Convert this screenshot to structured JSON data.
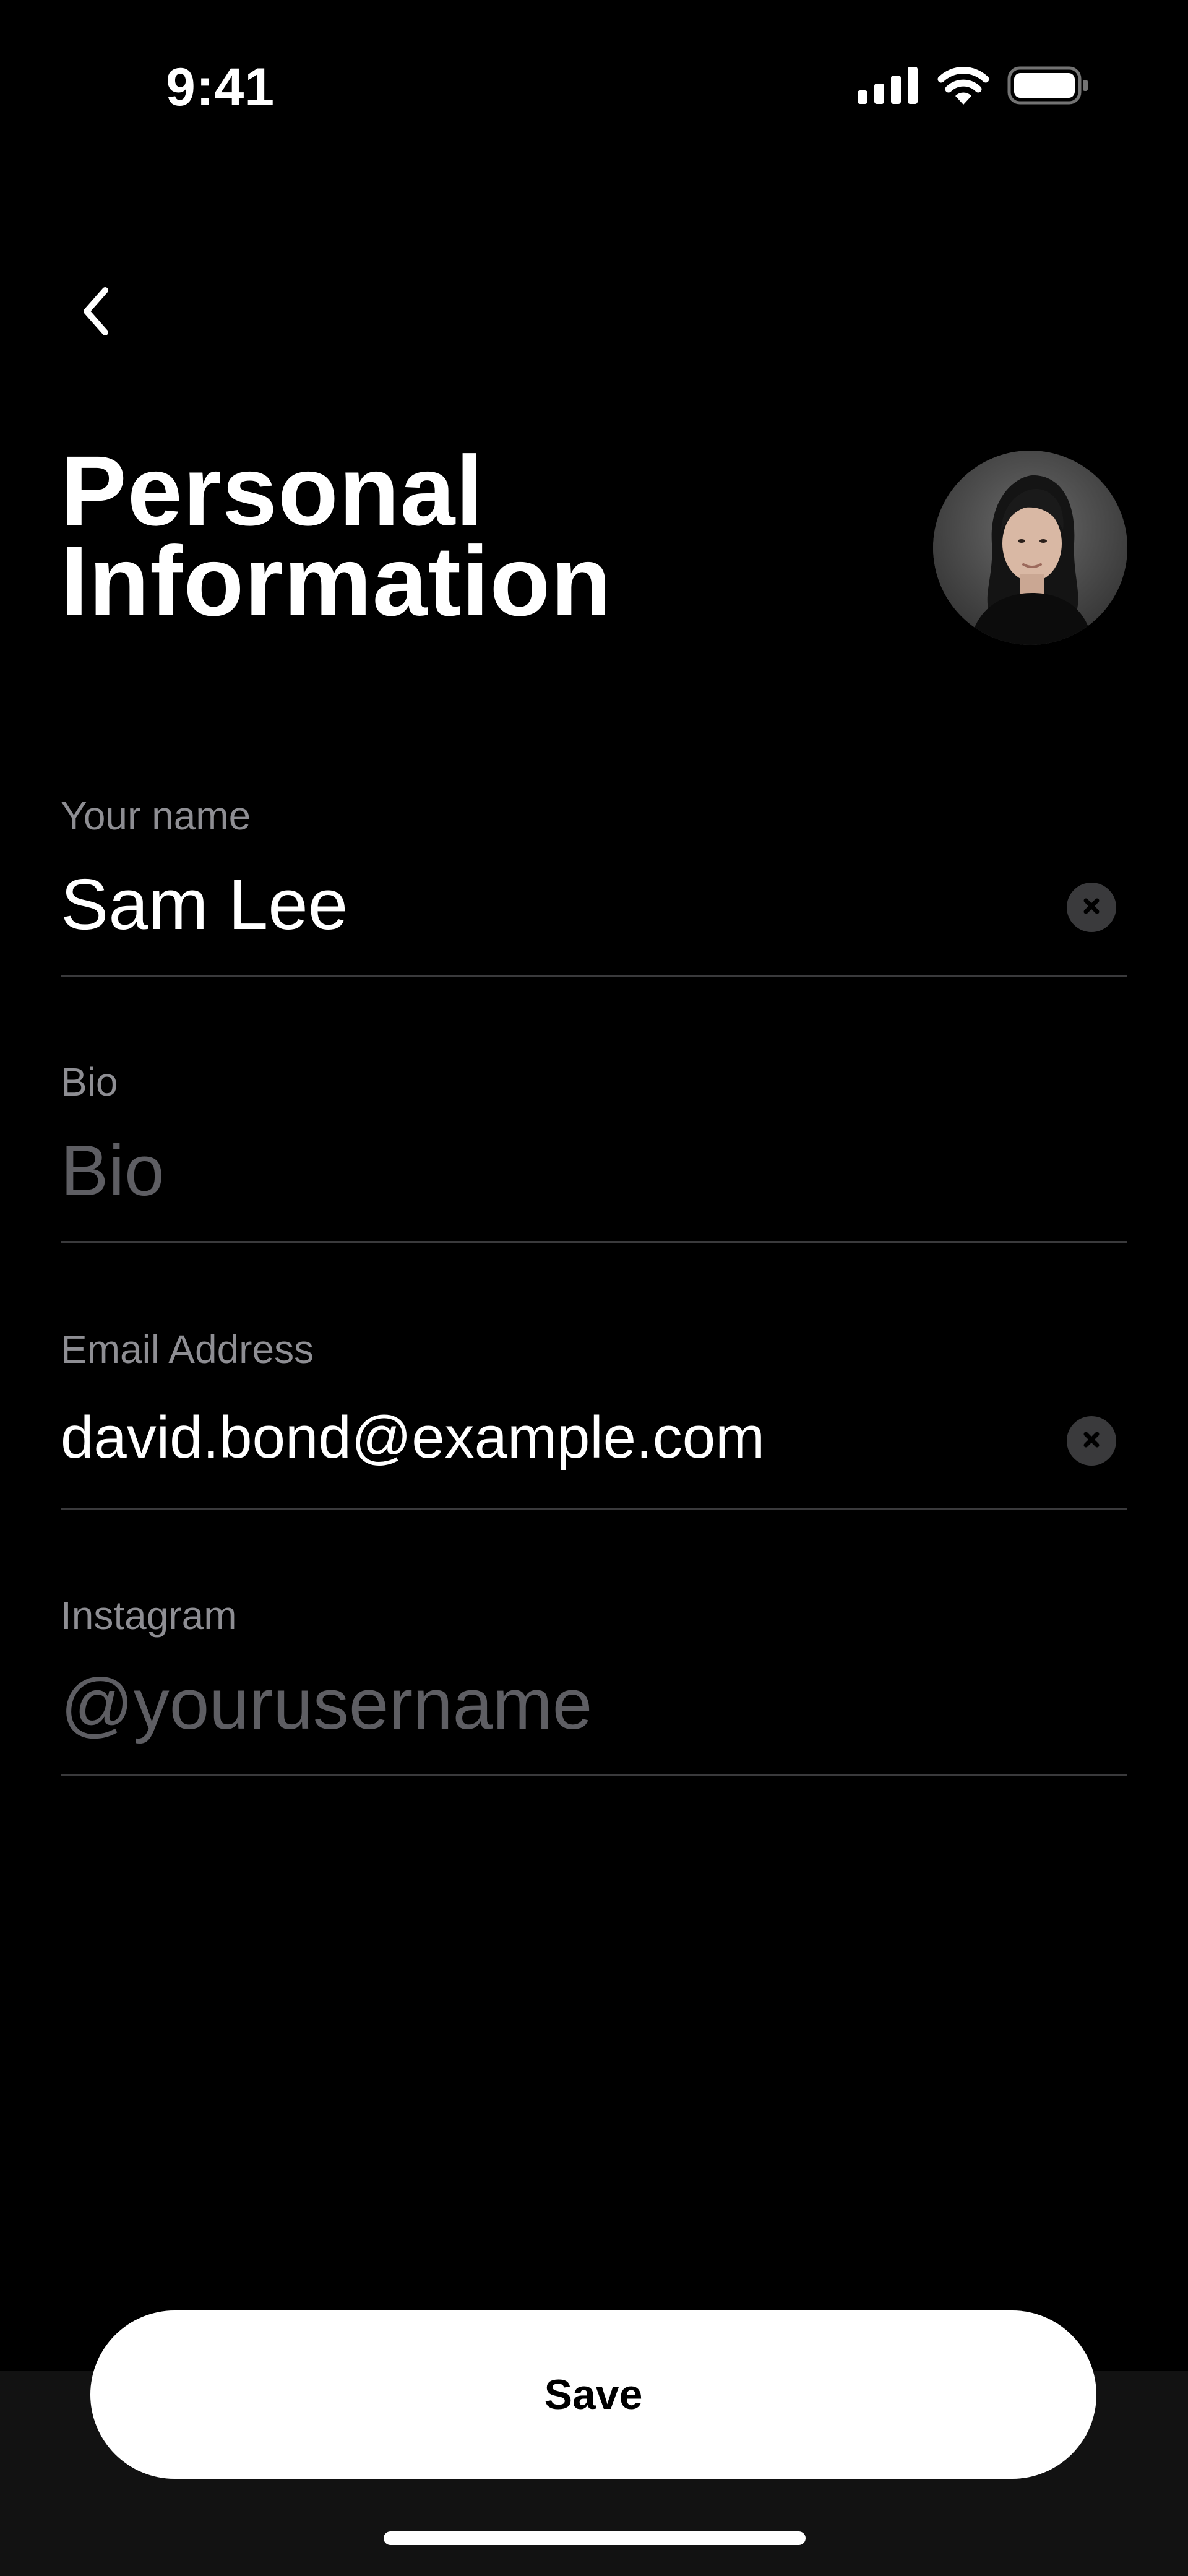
{
  "status_bar": {
    "time": "9:41",
    "icons": [
      "cellular-signal-icon",
      "wifi-icon",
      "battery-icon"
    ]
  },
  "header": {
    "back_icon": "chevron-left-icon",
    "title": "Personal\nInformation",
    "avatar": "user-avatar"
  },
  "form": {
    "name": {
      "label": "Your name",
      "value": "Sam Lee",
      "placeholder": ""
    },
    "bio": {
      "label": "Bio",
      "value": "",
      "placeholder": "Bio"
    },
    "email": {
      "label": "Email Address",
      "value": "david.bond@example.com",
      "placeholder": ""
    },
    "instagram": {
      "label": "Instagram",
      "value": "",
      "placeholder": "@yourusername"
    },
    "clear_icon": "clear-x-icon"
  },
  "footer": {
    "save_label": "Save"
  },
  "colors": {
    "background": "#000000",
    "text": "#ffffff",
    "label": "#8e8e93",
    "placeholder": "#5e5e63",
    "divider": "#3a3a3c",
    "button_bg": "#ffffff",
    "button_text": "#000000"
  }
}
